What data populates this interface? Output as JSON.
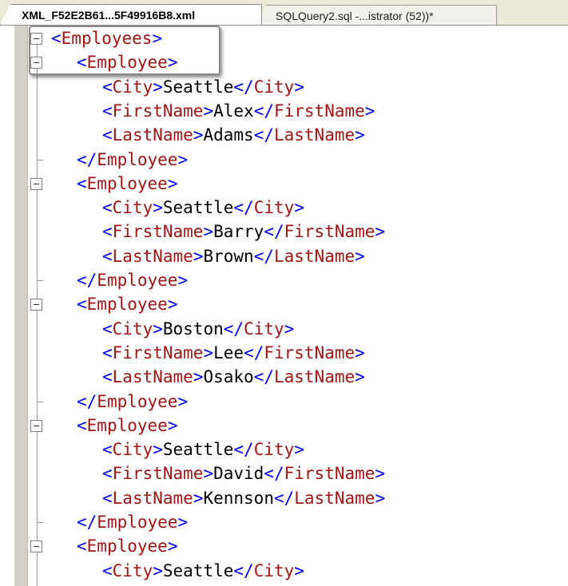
{
  "tabs": [
    {
      "label": "XML_F52E2B61...5F49916B8.xml",
      "active": true
    },
    {
      "label": "SQLQuery2.sql -...istrator (52))*",
      "active": false
    }
  ],
  "colors": {
    "tag": "#a31515",
    "bracket": "#0000ff",
    "text": "#000000"
  },
  "lines": [
    {
      "indent": 0,
      "open": "Employees",
      "fold": "box"
    },
    {
      "indent": 1,
      "open": "Employee",
      "fold": "box"
    },
    {
      "indent": 2,
      "open": "City",
      "text": "Seattle",
      "close": "City"
    },
    {
      "indent": 2,
      "open": "FirstName",
      "text": "Alex",
      "close": "FirstName"
    },
    {
      "indent": 2,
      "open": "LastName",
      "text": "Adams",
      "close": "LastName"
    },
    {
      "indent": 1,
      "close": "Employee",
      "fold": "tick"
    },
    {
      "indent": 1,
      "open": "Employee",
      "fold": "box"
    },
    {
      "indent": 2,
      "open": "City",
      "text": "Seattle",
      "close": "City"
    },
    {
      "indent": 2,
      "open": "FirstName",
      "text": "Barry",
      "close": "FirstName"
    },
    {
      "indent": 2,
      "open": "LastName",
      "text": "Brown",
      "close": "LastName"
    },
    {
      "indent": 1,
      "close": "Employee",
      "fold": "tick"
    },
    {
      "indent": 1,
      "open": "Employee",
      "fold": "box"
    },
    {
      "indent": 2,
      "open": "City",
      "text": "Boston",
      "close": "City"
    },
    {
      "indent": 2,
      "open": "FirstName",
      "text": "Lee",
      "close": "FirstName"
    },
    {
      "indent": 2,
      "open": "LastName",
      "text": "Osako",
      "close": "LastName"
    },
    {
      "indent": 1,
      "close": "Employee",
      "fold": "tick"
    },
    {
      "indent": 1,
      "open": "Employee",
      "fold": "box"
    },
    {
      "indent": 2,
      "open": "City",
      "text": "Seattle",
      "close": "City"
    },
    {
      "indent": 2,
      "open": "FirstName",
      "text": "David",
      "close": "FirstName"
    },
    {
      "indent": 2,
      "open": "LastName",
      "text": "Kennson",
      "close": "LastName"
    },
    {
      "indent": 1,
      "close": "Employee",
      "fold": "tick"
    },
    {
      "indent": 1,
      "open": "Employee",
      "fold": "box"
    },
    {
      "indent": 2,
      "open": "City",
      "text": "Seattle",
      "close": "City"
    }
  ]
}
